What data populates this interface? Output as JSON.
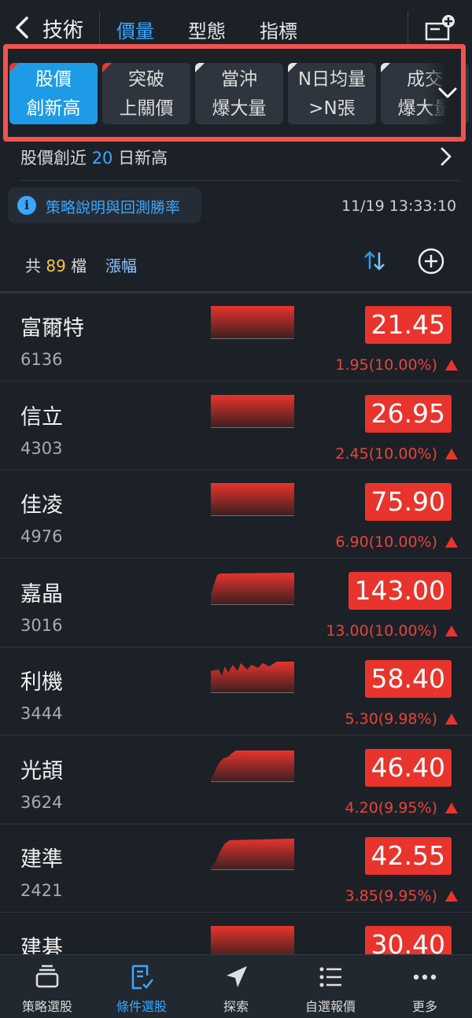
{
  "header": {
    "title": "技術",
    "tabs": [
      {
        "label": "價量",
        "active": true
      },
      {
        "label": "型態",
        "active": false
      },
      {
        "label": "指標",
        "active": false
      }
    ]
  },
  "chips": [
    {
      "line1": "股價",
      "line2": "創新高",
      "active": true
    },
    {
      "line1": "突破",
      "line2": "上關價",
      "active": false
    },
    {
      "line1": "當沖",
      "line2": "爆大量",
      "active": false
    },
    {
      "line1": "N日均量",
      "line2": ">N張",
      "active": false
    },
    {
      "line1": "成交",
      "line2": "爆大量",
      "active": false
    }
  ],
  "description": {
    "prefix": "股價創近",
    "days": "20",
    "suffix": "日新高"
  },
  "info": {
    "label": "策略說明與回測勝率",
    "timestamp": "11/19 13:33:10"
  },
  "list_header": {
    "count_prefix": "共",
    "count": "89",
    "count_suffix": "檔",
    "sort_field": "漲幅"
  },
  "stocks": [
    {
      "name": "富爾特",
      "code": "6136",
      "price": "21.45",
      "change": "1.95(10.00%)",
      "spark": "flat"
    },
    {
      "name": "信立",
      "code": "4303",
      "price": "26.95",
      "change": "2.45(10.00%)",
      "spark": "flat"
    },
    {
      "name": "佳凌",
      "code": "4976",
      "price": "75.90",
      "change": "6.90(10.00%)",
      "spark": "flat"
    },
    {
      "name": "嘉晶",
      "code": "3016",
      "price": "143.00",
      "change": "13.00(10.00%)",
      "spark": "rise"
    },
    {
      "name": "利機",
      "code": "3444",
      "price": "58.40",
      "change": "5.30(9.98%)",
      "spark": "jagged"
    },
    {
      "name": "光頡",
      "code": "3624",
      "price": "46.40",
      "change": "4.20(9.95%)",
      "spark": "ramp"
    },
    {
      "name": "建準",
      "code": "2421",
      "price": "42.55",
      "change": "3.85(9.95%)",
      "spark": "ramp2"
    },
    {
      "name": "建碁",
      "code": "",
      "price": "30.40",
      "change": "",
      "spark": "flat"
    }
  ],
  "bottom_nav": [
    {
      "label": "策略選股",
      "icon": "layers-icon",
      "active": false
    },
    {
      "label": "條件選股",
      "icon": "checklist-icon",
      "active": true
    },
    {
      "label": "探索",
      "icon": "navigate-icon",
      "active": false
    },
    {
      "label": "自選報價",
      "icon": "list-icon",
      "active": false
    },
    {
      "label": "更多",
      "icon": "more-icon",
      "active": false
    }
  ],
  "colors": {
    "accent": "#3aa7ff",
    "up": "#e8342c",
    "highlight": "#ef5350",
    "count": "#f5c542"
  }
}
